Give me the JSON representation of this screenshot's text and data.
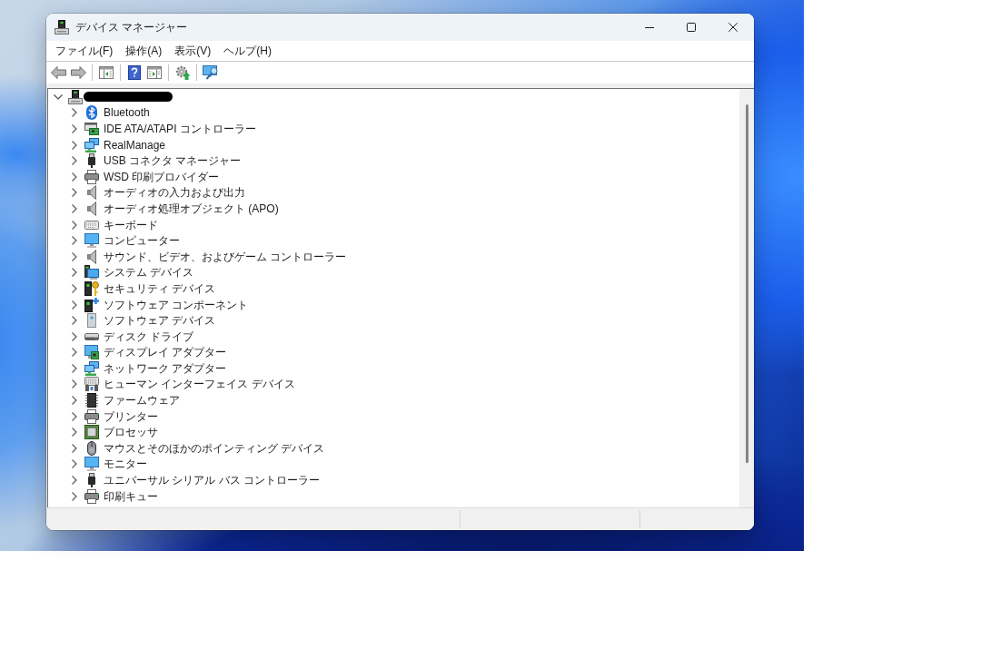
{
  "window": {
    "title": "デバイス マネージャー"
  },
  "menu": [
    "ファイル(F)",
    "操作(A)",
    "表示(V)",
    "ヘルプ(H)"
  ],
  "toolbar": [
    [
      {
        "kind": "back"
      },
      {
        "kind": "forward"
      }
    ],
    [
      {
        "kind": "console-tree"
      }
    ],
    [
      {
        "kind": "help"
      },
      {
        "kind": "action-pane"
      }
    ],
    [
      {
        "kind": "update-driver"
      }
    ],
    [
      {
        "kind": "scan"
      }
    ]
  ],
  "tree": {
    "root": {
      "kind": "host",
      "redacted": true,
      "expanded": true,
      "children": [
        {
          "kind": "bluetooth",
          "label": "Bluetooth",
          "expanded": false
        },
        {
          "kind": "ide",
          "label": "IDE ATA/ATAPI コントローラー",
          "expanded": false
        },
        {
          "kind": "network",
          "label": "RealManage",
          "expanded": false
        },
        {
          "kind": "usb",
          "label": "USB コネクタ マネージャー",
          "expanded": false
        },
        {
          "kind": "printer",
          "label": "WSD 印刷プロバイダー",
          "expanded": false
        },
        {
          "kind": "speaker",
          "label": "オーディオの入力および出力",
          "expanded": false
        },
        {
          "kind": "speaker",
          "label": "オーディオ処理オブジェクト (APO)",
          "expanded": false
        },
        {
          "kind": "keyboard",
          "label": "キーボード",
          "expanded": false
        },
        {
          "kind": "monitor",
          "label": "コンピューター",
          "expanded": false
        },
        {
          "kind": "speaker",
          "label": "サウンド、ビデオ、およびゲーム コントローラー",
          "expanded": false
        },
        {
          "kind": "system",
          "label": "システム デバイス",
          "expanded": false
        },
        {
          "kind": "security",
          "label": "セキュリティ デバイス",
          "expanded": false
        },
        {
          "kind": "component",
          "label": "ソフトウェア コンポーネント",
          "expanded": false
        },
        {
          "kind": "software",
          "label": "ソフトウェア デバイス",
          "expanded": false
        },
        {
          "kind": "disk",
          "label": "ディスク ドライブ",
          "expanded": false
        },
        {
          "kind": "display",
          "label": "ディスプレイ アダプター",
          "expanded": false
        },
        {
          "kind": "network",
          "label": "ネットワーク アダプター",
          "expanded": false
        },
        {
          "kind": "hid",
          "label": "ヒューマン インターフェイス デバイス",
          "expanded": false
        },
        {
          "kind": "firmware",
          "label": "ファームウェア",
          "expanded": false
        },
        {
          "kind": "printer",
          "label": "プリンター",
          "expanded": false
        },
        {
          "kind": "processor",
          "label": "プロセッサ",
          "expanded": false
        },
        {
          "kind": "mouse",
          "label": "マウスとそのほかのポインティング デバイス",
          "expanded": false
        },
        {
          "kind": "monitor",
          "label": "モニター",
          "expanded": false
        },
        {
          "kind": "usb",
          "label": "ユニバーサル シリアル バス コントローラー",
          "expanded": false
        },
        {
          "kind": "printer",
          "label": "印刷キュー",
          "expanded": false
        }
      ]
    }
  }
}
